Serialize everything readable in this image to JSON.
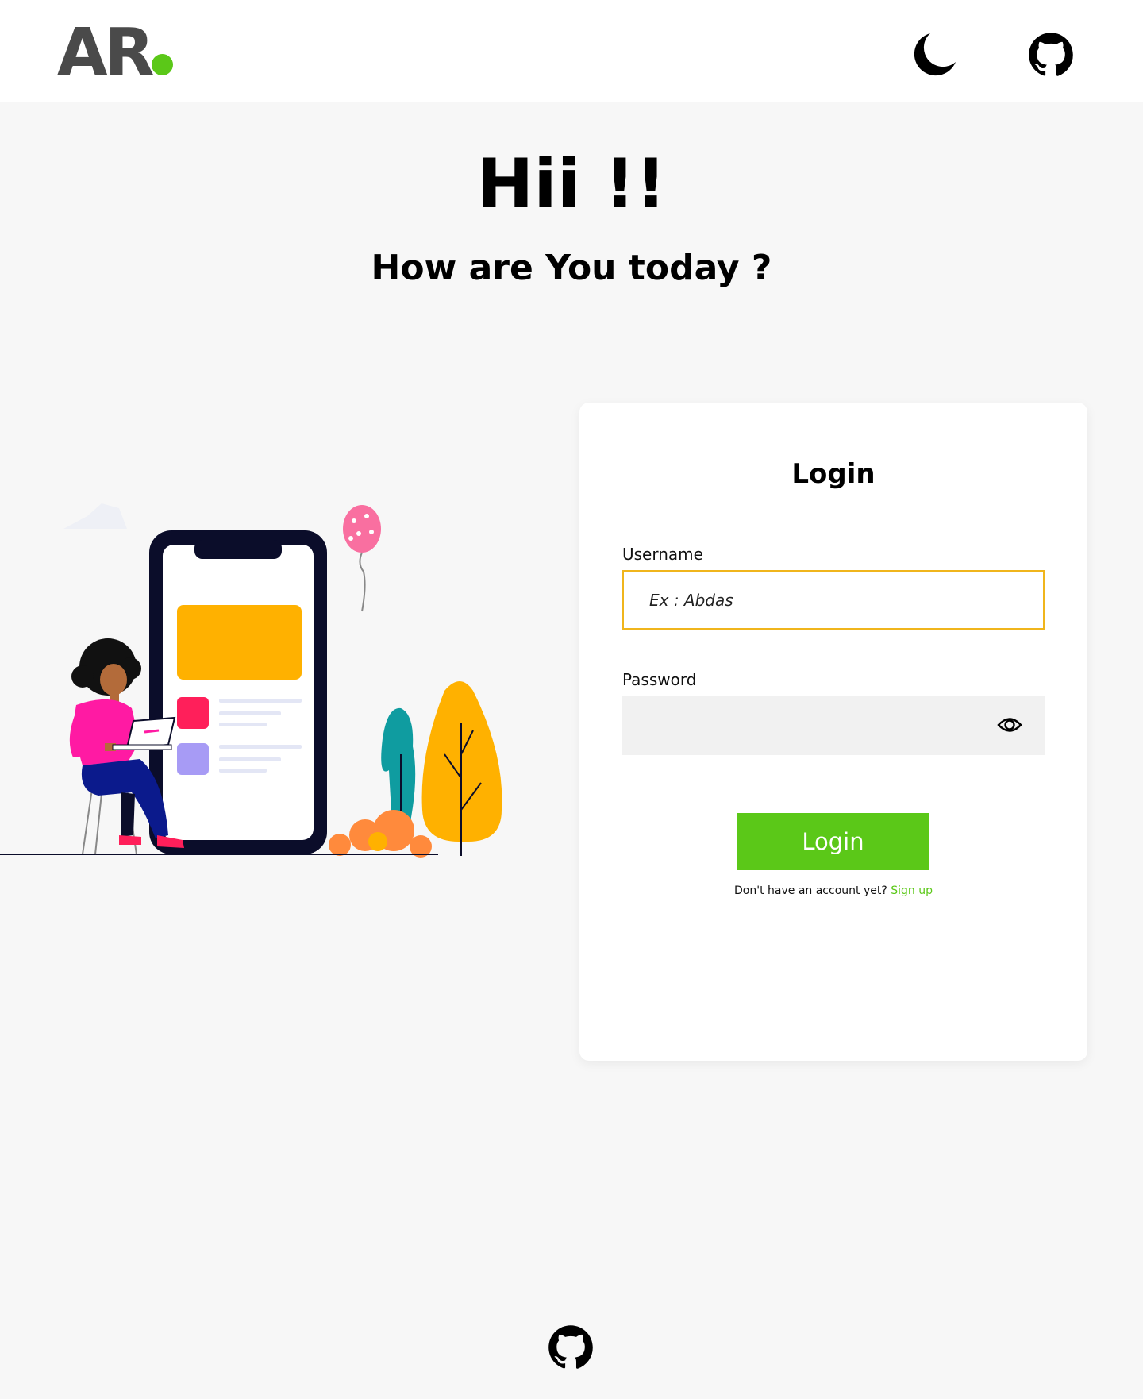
{
  "header": {
    "logo_text": "AR",
    "theme_toggle_icon": "moon-icon",
    "github_icon": "github-icon"
  },
  "hero": {
    "title": "Hii !!",
    "subtitle": "How are You today ?"
  },
  "illustration": {
    "icon": "person-with-phone-illustration"
  },
  "login_card": {
    "title": "Login",
    "username_label": "Username",
    "username_placeholder": "Ex : Abdas",
    "username_value": "",
    "password_label": "Password",
    "password_value": "",
    "password_visibility_icon": "eye-icon",
    "submit_label": "Login",
    "signup_prompt": "Don't have an account yet?",
    "signup_link": "Sign up"
  },
  "footer": {
    "github_icon": "github-icon"
  },
  "colors": {
    "accent": "#5bc818",
    "input_focus_border": "#f0b51c",
    "page_background": "#f7f7f7",
    "logo": "#4a4a4a"
  }
}
